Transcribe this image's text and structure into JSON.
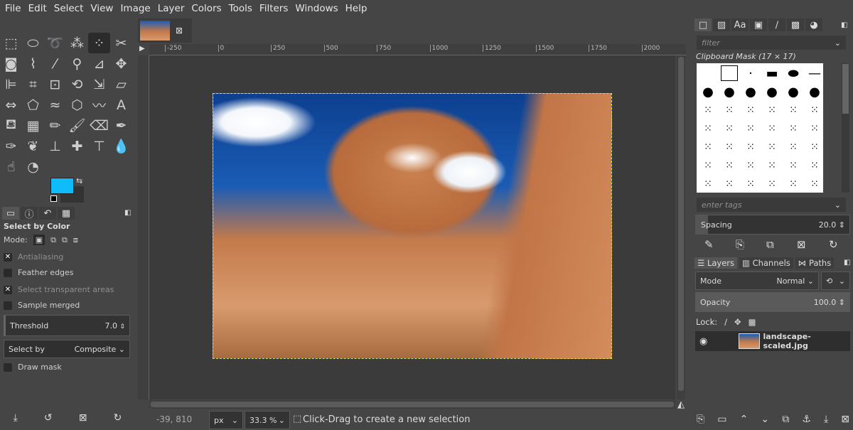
{
  "menu": [
    "File",
    "Edit",
    "Select",
    "View",
    "Image",
    "Layer",
    "Colors",
    "Tools",
    "Filters",
    "Windows",
    "Help"
  ],
  "tools": [
    "rect-select",
    "ellipse-select",
    "free-select",
    "fuzzy-select",
    "select-by-color",
    "scissors",
    "foreground-select",
    "paths",
    "color-picker",
    "zoom",
    "measure",
    "move",
    "align",
    "crop",
    "unified-transform",
    "rotate",
    "scale",
    "shear",
    "flip",
    "perspective",
    "warp-transform",
    "cage-transform",
    "smudge-warp",
    "text",
    "bucket-fill",
    "gradient",
    "pencil",
    "paintbrush",
    "eraser",
    "airbrush",
    "ink",
    "mypaint-brush",
    "clone",
    "heal",
    "perspective-clone",
    "blur",
    "smudge",
    "dodge-burn"
  ],
  "colors": {
    "foreground": "#0fbcf9",
    "background": "#333333",
    "selection": "#e7d84a"
  },
  "tool_options": {
    "title": "Select by Color",
    "mode_label": "Mode:",
    "antialiasing": "Antialiasing",
    "feather": "Feather edges",
    "transparent": "Select transparent areas",
    "sample_merged": "Sample merged",
    "threshold_label": "Threshold",
    "threshold_value": "7.0",
    "select_by_label": "Select by",
    "select_by_value": "Composite",
    "draw_mask": "Draw mask",
    "checked": {
      "antialiasing": true,
      "feather": false,
      "transparent": true,
      "sample_merged": false,
      "draw_mask": false
    }
  },
  "ruler": [
    "-250",
    "0",
    "250",
    "500",
    "750",
    "1000",
    "1250",
    "1500",
    "1750",
    "2000"
  ],
  "status": {
    "coords": "-39, 810",
    "unit": "px",
    "zoom": "33.3 %",
    "message": "Click-Drag to create a new selection"
  },
  "brushes": {
    "filter_placeholder": "filter",
    "title": "Clipboard Mask (17 × 17)",
    "tags_placeholder": "enter tags",
    "spacing_label": "Spacing",
    "spacing_value": "20.0"
  },
  "layers": {
    "tabs": [
      "Layers",
      "Channels",
      "Paths"
    ],
    "mode_label": "Mode",
    "mode_value": "Normal",
    "opacity_label": "Opacity",
    "opacity_value": "100.0",
    "lock_label": "Lock:",
    "items": [
      {
        "name": "landscape-scaled.jpg",
        "visible": true
      }
    ]
  }
}
